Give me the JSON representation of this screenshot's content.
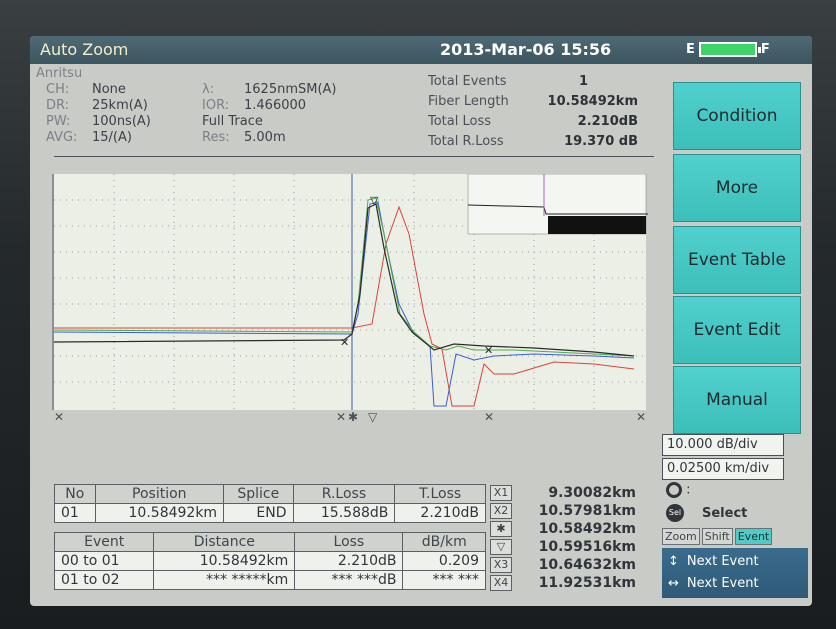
{
  "title_bar": {
    "mode": "Auto Zoom",
    "datetime": "2013-Mar-06 15:56",
    "battery_left": "E",
    "battery_right": "F"
  },
  "header": {
    "brand": "Anritsu",
    "params_left": [
      {
        "key": "CH:",
        "value": "None"
      },
      {
        "key": "DR:",
        "value": "25km(A)"
      },
      {
        "key": "PW:",
        "value": "100ns(A)"
      },
      {
        "key": "AVG:",
        "value": "15/(A)"
      }
    ],
    "params_mid": [
      {
        "key": "λ:",
        "value": "1625nmSM(A)"
      },
      {
        "key": "IOR:",
        "value": "1.466000"
      },
      {
        "key": "",
        "value": "Full Trace"
      },
      {
        "key": "Res:",
        "value": "5.00m"
      }
    ],
    "stats": [
      {
        "key": "Total Events",
        "value": "1"
      },
      {
        "key": "Fiber Length",
        "value": "10.58492km"
      },
      {
        "key": "Total Loss",
        "value": "2.210dB"
      },
      {
        "key": "Total R.Loss",
        "value": "19.370 dB"
      }
    ]
  },
  "event_table": {
    "headers": [
      "No",
      "Position",
      "Splice",
      "R.Loss",
      "T.Loss"
    ],
    "rows": [
      [
        "01",
        "10.58492km",
        "END",
        "15.588dB",
        "2.210dB"
      ]
    ]
  },
  "loss_table": {
    "headers": [
      "Event",
      "Distance",
      "Loss",
      "dB/km"
    ],
    "rows": [
      [
        "00 to 01",
        "10.58492km",
        "2.210dB",
        "0.209"
      ],
      [
        "01 to 02",
        "*** *****km",
        "*** ***dB",
        "*** ***"
      ]
    ]
  },
  "cursors": [
    {
      "symbol": "X1",
      "value": "9.30082km"
    },
    {
      "symbol": "X2",
      "value": "10.57981km"
    },
    {
      "symbol": "✱",
      "value": "10.58492km"
    },
    {
      "symbol": "▽",
      "value": "10.59516km"
    },
    {
      "symbol": "X3",
      "value": "10.64632km"
    },
    {
      "symbol": "X4",
      "value": "11.92531km"
    }
  ],
  "softkeys": [
    "Condition",
    "More",
    "Event Table",
    "Event Edit",
    "Manual"
  ],
  "scale": {
    "db_div": "10.000 dB/div",
    "km_div": "0.02500 km/div"
  },
  "knob": {
    "colon": ":",
    "sel_icon": "Sel",
    "select_label": "Select"
  },
  "mode_tabs": [
    "Zoom",
    "Shift",
    "Event"
  ],
  "nav": {
    "updown_label": "Next Event",
    "leftright_label": "Next Event"
  },
  "colors": {
    "accent_teal": "#45c7c3",
    "trace_black": "#2b2b2b",
    "trace_green": "#4cab4c",
    "trace_blue": "#3a5fd0",
    "trace_red": "#d9453a"
  }
}
